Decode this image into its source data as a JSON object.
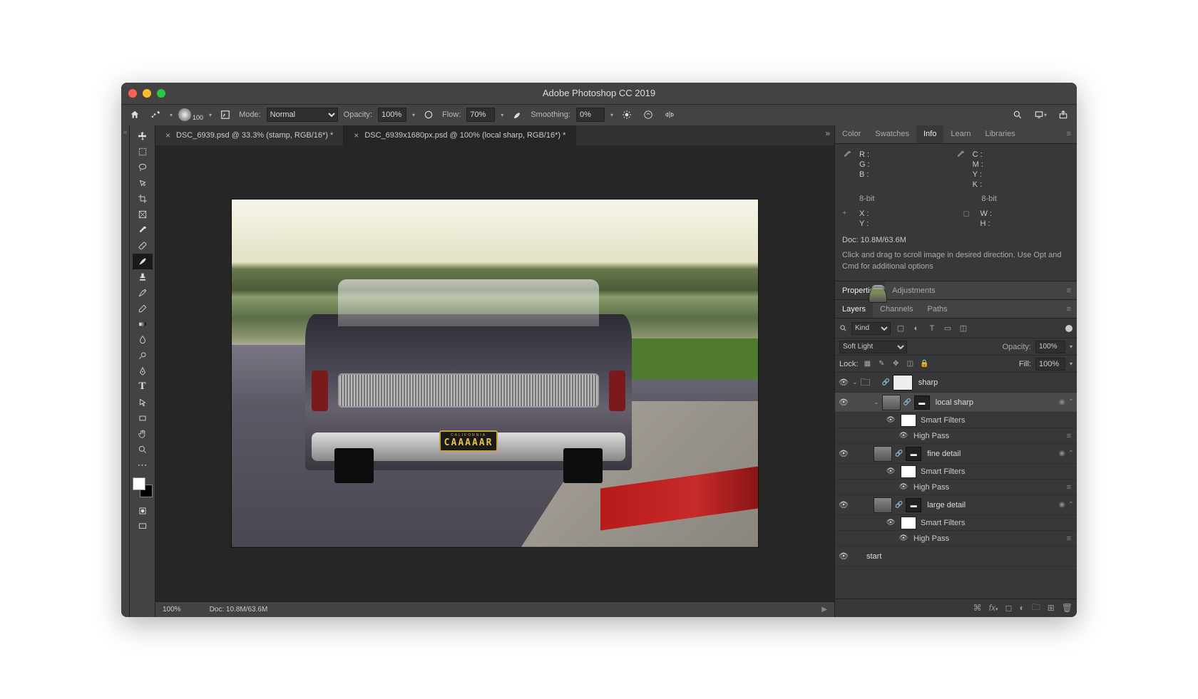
{
  "app_title": "Adobe Photoshop CC 2019",
  "options_bar": {
    "brush_size": "100",
    "mode_label": "Mode:",
    "mode_value": "Normal",
    "opacity_label": "Opacity:",
    "opacity_value": "100%",
    "flow_label": "Flow:",
    "flow_value": "70%",
    "smoothing_label": "Smoothing:",
    "smoothing_value": "0%"
  },
  "document_tabs": [
    {
      "label": "DSC_6939.psd @ 33.3% (stamp, RGB/16*) *",
      "active": false
    },
    {
      "label": "DSC_6939x1680px.psd @ 100% (local sharp, RGB/16*) *",
      "active": true
    }
  ],
  "plate": {
    "state": "CALIFORNIA",
    "text": "CAAAAAR"
  },
  "statusbar": {
    "zoom": "100%",
    "doc": "Doc: 10.8M/63.6M"
  },
  "right_tabs_top": [
    "Color",
    "Swatches",
    "Info",
    "Learn",
    "Libraries"
  ],
  "right_tabs_top_active": "Info",
  "info_panel": {
    "rgb": {
      "R": "R :",
      "G": "G :",
      "B": "B :"
    },
    "cmyk": {
      "C": "C :",
      "M": "M :",
      "Y": "Y :",
      "K": "K :"
    },
    "bit1": "8-bit",
    "bit2": "8-bit",
    "xy": {
      "X": "X :",
      "Y": "Y :"
    },
    "wh": {
      "W": "W :",
      "H": "H :"
    },
    "doc": "Doc: 10.8M/63.6M",
    "help": "Click and drag to scroll image in desired direction.  Use Opt and Cmd for additional options"
  },
  "mid_tabs": [
    "Properties",
    "Adjustments"
  ],
  "mid_tabs_active": "Properties",
  "layer_tabs": [
    "Layers",
    "Channels",
    "Paths"
  ],
  "layer_tabs_active": "Layers",
  "layer_filter": {
    "kind": "Kind"
  },
  "layer_blend": {
    "mode": "Soft Light",
    "opacity_label": "Opacity:",
    "opacity_value": "100%"
  },
  "layer_lock": {
    "label": "Lock:",
    "fill_label": "Fill:",
    "fill_value": "100%"
  },
  "layers": [
    {
      "type": "group",
      "name": "sharp",
      "indent": 0
    },
    {
      "type": "smart",
      "name": "local sharp",
      "indent": 1,
      "selected": true,
      "badges": true
    },
    {
      "type": "sf_header",
      "name": "Smart Filters",
      "indent": 2
    },
    {
      "type": "sf",
      "name": "High Pass",
      "indent": 2
    },
    {
      "type": "smart",
      "name": "fine detail",
      "indent": 1,
      "badges": true
    },
    {
      "type": "sf_header",
      "name": "Smart Filters",
      "indent": 2
    },
    {
      "type": "sf",
      "name": "High Pass",
      "indent": 2
    },
    {
      "type": "smart",
      "name": "large detail",
      "indent": 1,
      "badges": true
    },
    {
      "type": "sf_header",
      "name": "Smart Filters",
      "indent": 2
    },
    {
      "type": "sf",
      "name": "High Pass",
      "indent": 2
    },
    {
      "type": "layer",
      "name": "start",
      "indent": 0
    }
  ]
}
